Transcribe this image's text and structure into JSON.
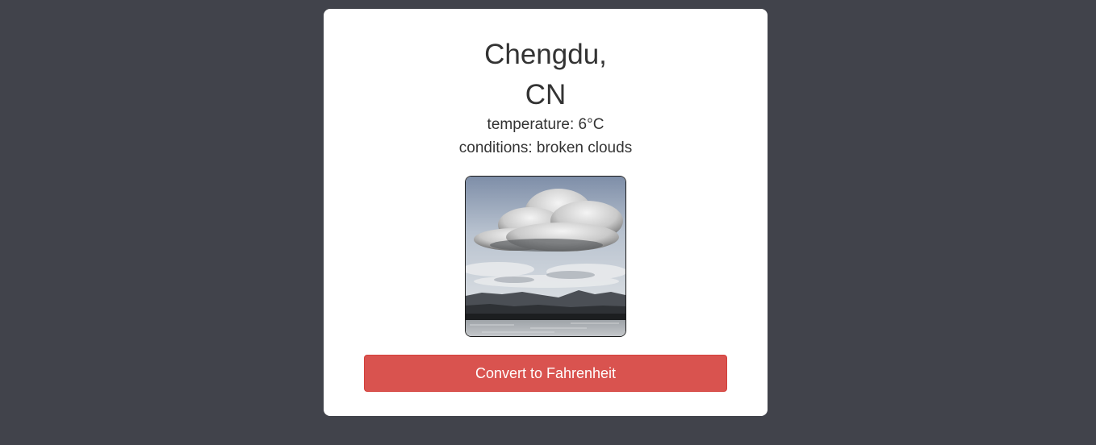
{
  "location": {
    "city": "Chengdu,",
    "country": "CN"
  },
  "weather": {
    "temperature_text": "temperature: 6°C",
    "conditions_text": "conditions: broken clouds"
  },
  "image": {
    "subject": "broken-clouds-photo"
  },
  "actions": {
    "convert_label": "Convert to Fahrenheit"
  },
  "colors": {
    "background": "#41434b",
    "card": "#ffffff",
    "button": "#d9534f",
    "text": "#333333"
  }
}
